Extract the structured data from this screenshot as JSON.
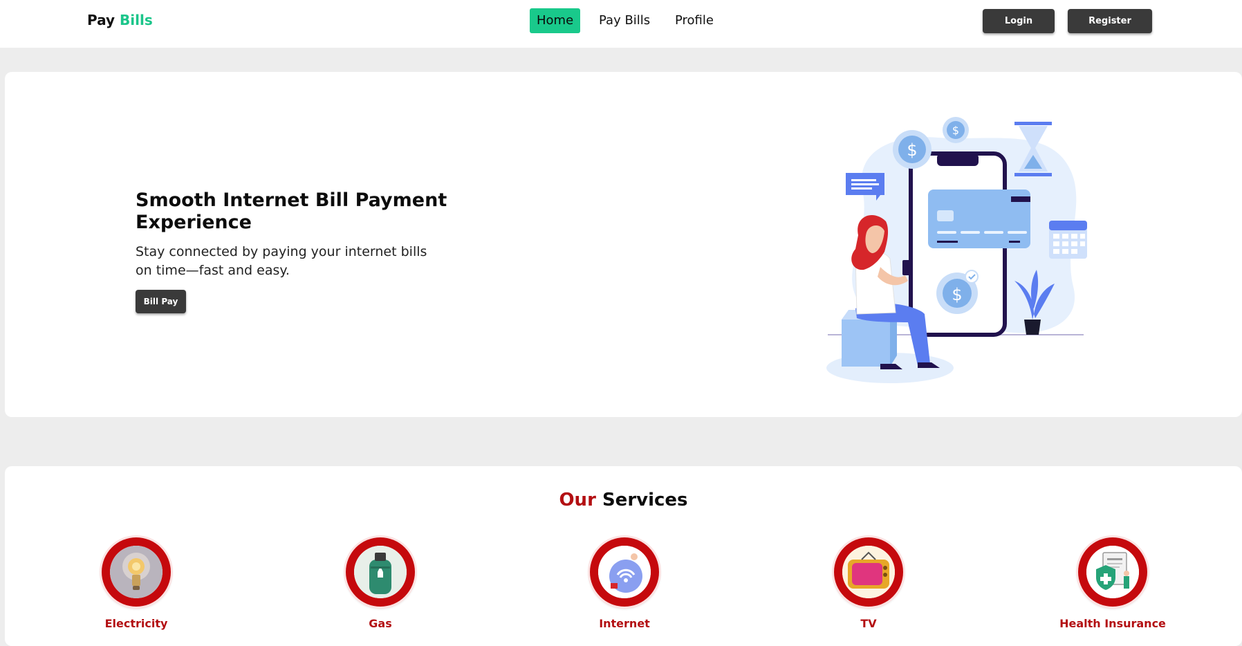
{
  "nav": {
    "brand_main": "Pay",
    "brand_accent": "Bills",
    "links": [
      "Home",
      "Pay Bills",
      "Profile"
    ],
    "active_link": "Home",
    "login_label": "Login",
    "register_label": "Register"
  },
  "hero": {
    "title": "Smooth Internet Bill Payment Experience",
    "subtitle": "Stay connected by paying your internet bills on time—fast and easy.",
    "button_label": "Bill Pay"
  },
  "services": {
    "title_accent": "Our",
    "title_main": "Services",
    "items": [
      {
        "label": "Electricity",
        "icon": "lightbulb-icon"
      },
      {
        "label": "Gas",
        "icon": "gas-cylinder-icon"
      },
      {
        "label": "Internet",
        "icon": "wifi-icon"
      },
      {
        "label": "TV",
        "icon": "tv-icon"
      },
      {
        "label": "Health Insurance",
        "icon": "health-insurance-icon"
      }
    ]
  },
  "colors": {
    "brand_accent": "#1bc58a",
    "nav_active": "#19c98b",
    "dark_button": "#3a3a3a",
    "service_red": "#b30f12",
    "page_bg": "#ededed"
  }
}
